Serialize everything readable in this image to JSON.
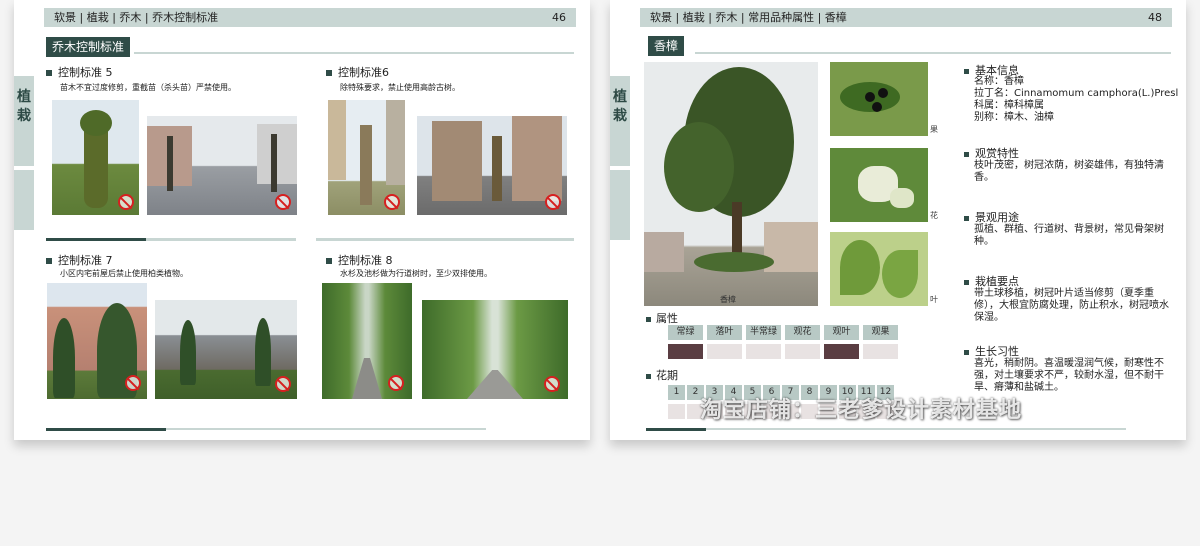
{
  "left_page": {
    "breadcrumb": "软景 | 植栽 | 乔木 | 乔木控制标准",
    "page_number": "46",
    "side_tag": "植栽",
    "section_title": "乔木控制标准",
    "standards": [
      {
        "title": "控制标准 5",
        "desc": "苗木不宜过度修剪，重截苗（杀头苗）严禁使用。"
      },
      {
        "title": "控制标准6",
        "desc": "除特殊要求，禁止使用高龄古树。"
      },
      {
        "title": "控制标准 7",
        "desc": "小区内宅前屋后禁止使用柏类植物。"
      },
      {
        "title": "控制标准 8",
        "desc": "水杉及池杉做为行道树时，至少双排使用。"
      }
    ]
  },
  "right_page": {
    "breadcrumb": "软景 | 植栽 | 乔木 | 常用品种属性 | 香樟",
    "page_number": "48",
    "side_tag": "植栽",
    "section_title": "香樟",
    "main_photo_caption": "香樟",
    "thumb_captions": [
      "果",
      "花",
      "叶"
    ],
    "info": [
      {
        "title": "基本信息",
        "lines": [
          "名称：香樟",
          "拉丁名：Cinnamomum camphora(L.)Presl",
          "科属：樟科樟属",
          "别称：樟木、油樟"
        ]
      },
      {
        "title": "观赏特性",
        "lines": [
          "枝叶茂密，树冠浓荫，树姿雄伟，有独特清香。"
        ]
      },
      {
        "title": "景观用途",
        "lines": [
          "孤植、群植、行道树、背景树，常见骨架树种。"
        ]
      },
      {
        "title": "栽植要点",
        "lines": [
          "带土球移植，树冠叶片适当修剪（夏季重修），大根宜防腐处理，防止积水，树冠喷水保湿。"
        ]
      },
      {
        "title": "生长习性",
        "lines": [
          "喜光，稍耐阴。喜温暖湿润气候，耐寒性不强，对土壤要求不严，较耐水湿，但不耐干旱、瘠薄和盐碱土。"
        ]
      }
    ],
    "attributes": {
      "label": "属性",
      "headers": [
        "常绿",
        "落叶",
        "半常绿",
        "观花",
        "观叶",
        "观果"
      ],
      "selected": [
        true,
        false,
        false,
        false,
        true,
        false
      ]
    },
    "flowering": {
      "label": "花期",
      "months": [
        "1",
        "2",
        "3",
        "4",
        "5",
        "6",
        "7",
        "8",
        "9",
        "10",
        "11",
        "12"
      ]
    }
  },
  "watermark": "淘宝店铺：三老爹设计素材基地"
}
